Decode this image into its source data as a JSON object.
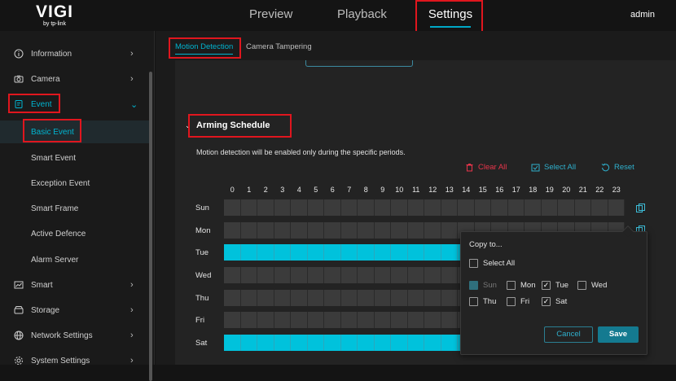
{
  "app": {
    "brand": "VIGI",
    "brand_sub": "by tp-link",
    "user": "admin"
  },
  "top_nav": [
    {
      "label": "Preview"
    },
    {
      "label": "Playback"
    },
    {
      "label": "Settings",
      "active": true
    }
  ],
  "sidebar": {
    "items": [
      {
        "label": "Information",
        "icon": "info-icon"
      },
      {
        "label": "Camera",
        "icon": "camera-icon"
      },
      {
        "label": "Event",
        "icon": "event-icon",
        "expanded": true
      },
      {
        "label": "Basic Event",
        "selected": true
      },
      {
        "label": "Smart Event"
      },
      {
        "label": "Exception Event"
      },
      {
        "label": "Smart Frame"
      },
      {
        "label": "Active Defence"
      },
      {
        "label": "Alarm Server"
      },
      {
        "label": "Smart",
        "icon": "chart-icon"
      },
      {
        "label": "Storage",
        "icon": "storage-icon"
      },
      {
        "label": "Network Settings",
        "icon": "globe-icon"
      },
      {
        "label": "System Settings",
        "icon": "gear-icon"
      }
    ]
  },
  "tabs": [
    {
      "label": "Motion Detection",
      "active": true
    },
    {
      "label": "Camera Tampering"
    }
  ],
  "arming": {
    "title": "Arming Schedule",
    "description": "Motion detection will be enabled only during the specific periods.",
    "clear_all": "Clear All",
    "select_all": "Select All",
    "reset": "Reset",
    "hours": [
      "0",
      "1",
      "2",
      "3",
      "4",
      "5",
      "6",
      "7",
      "8",
      "9",
      "10",
      "11",
      "12",
      "13",
      "14",
      "15",
      "16",
      "17",
      "18",
      "19",
      "20",
      "21",
      "22",
      "23"
    ],
    "days": [
      {
        "label": "Sun",
        "armed": false
      },
      {
        "label": "Mon",
        "armed": false
      },
      {
        "label": "Tue",
        "armed": true
      },
      {
        "label": "Wed",
        "armed": false
      },
      {
        "label": "Thu",
        "armed": false
      },
      {
        "label": "Fri",
        "armed": false
      },
      {
        "label": "Sat",
        "armed": true
      }
    ],
    "accent_color": "#00c2dc"
  },
  "copy_popup": {
    "title": "Copy to...",
    "select_all": "Select All",
    "days": [
      {
        "label": "Sun",
        "checked": true,
        "disabled": true
      },
      {
        "label": "Mon",
        "checked": false
      },
      {
        "label": "Tue",
        "checked": true
      },
      {
        "label": "Wed",
        "checked": false
      },
      {
        "label": "Thu",
        "checked": false
      },
      {
        "label": "Fri",
        "checked": false
      },
      {
        "label": "Sat",
        "checked": true
      }
    ],
    "cancel": "Cancel",
    "save": "Save"
  }
}
